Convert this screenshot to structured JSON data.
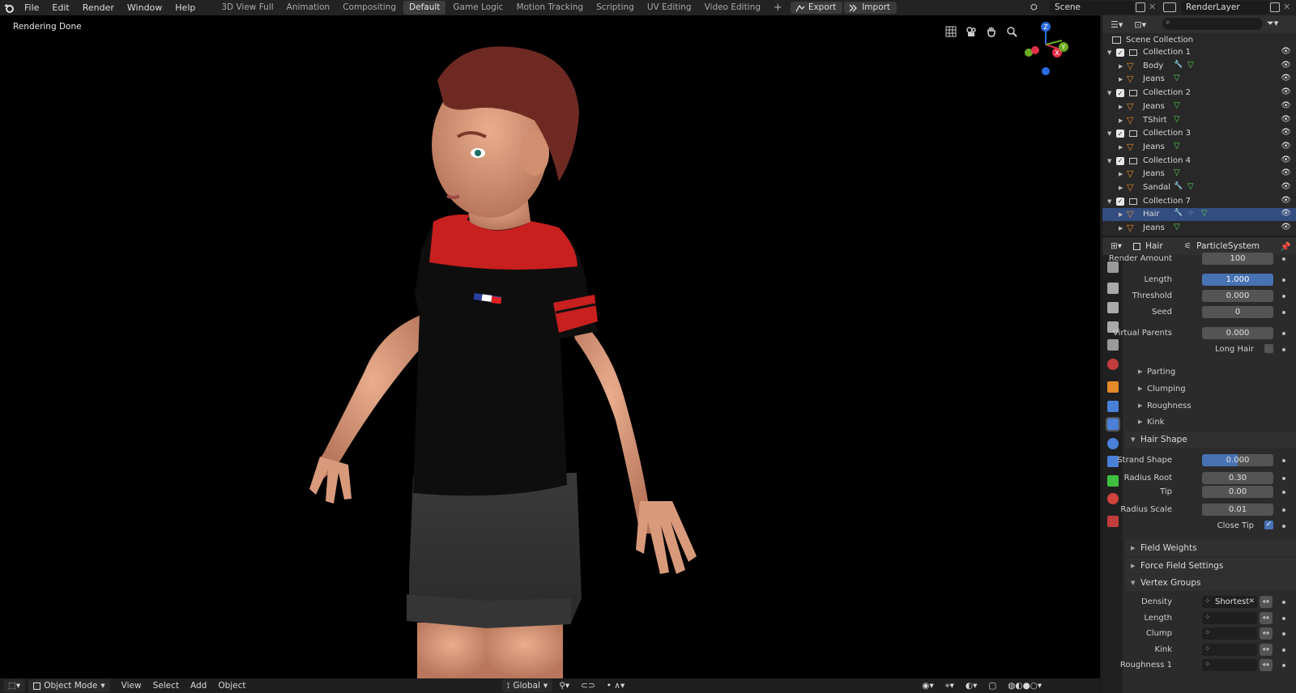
{
  "topbar": {
    "menus": [
      "File",
      "Edit",
      "Render",
      "Window",
      "Help"
    ],
    "workspaces": [
      "3D View Full",
      "Animation",
      "Compositing",
      "Default",
      "Game Logic",
      "Motion Tracking",
      "Scripting",
      "UV Editing",
      "Video Editing"
    ],
    "active_workspace": "Default",
    "add_tab": "+",
    "export_label": "Export",
    "import_label": "Import",
    "scene_name": "Scene",
    "render_layer": "RenderLayer"
  },
  "viewport": {
    "status": "Rendering Done",
    "gizmo": {
      "z": "Z",
      "x": "X",
      "y": "Y"
    }
  },
  "bottombar": {
    "mode": "Object Mode",
    "menus": [
      "View",
      "Select",
      "Add",
      "Object"
    ],
    "transform_orientation": "Global"
  },
  "outliner": {
    "root": "Scene Collection",
    "rows": [
      {
        "label": "Collection 1",
        "kind": "collection"
      },
      {
        "label": "Body",
        "kind": "object",
        "extras": [
          "wrench",
          "mesh"
        ]
      },
      {
        "label": "Jeans",
        "kind": "object",
        "extras": [
          "mesh"
        ]
      },
      {
        "label": "Collection 2",
        "kind": "collection"
      },
      {
        "label": "Jeans",
        "kind": "object",
        "extras": [
          "mesh"
        ]
      },
      {
        "label": "TShirt",
        "kind": "object",
        "extras": [
          "mesh"
        ]
      },
      {
        "label": "Collection 3",
        "kind": "collection"
      },
      {
        "label": "Jeans",
        "kind": "object",
        "extras": [
          "mesh"
        ]
      },
      {
        "label": "Collection 4",
        "kind": "collection"
      },
      {
        "label": "Jeans",
        "kind": "object",
        "extras": [
          "mesh"
        ]
      },
      {
        "label": "Sandal",
        "kind": "object",
        "extras": [
          "wrench",
          "mesh"
        ]
      },
      {
        "label": "Collection 7",
        "kind": "collection"
      },
      {
        "label": "Hair",
        "kind": "object",
        "extras": [
          "wrench",
          "particles",
          "mesh"
        ],
        "selected": true
      },
      {
        "label": "Jeans",
        "kind": "object",
        "extras": [
          "mesh"
        ]
      }
    ]
  },
  "properties": {
    "object_name": "Hair",
    "particle_system": "ParticleSystem",
    "render_amount_label": "Render Amount",
    "render_amount": "100",
    "length_label": "Length",
    "length": "1.000",
    "threshold_label": "Threshold",
    "threshold": "0.000",
    "seed_label": "Seed",
    "seed": "0",
    "virtual_parents_label": "Virtual Parents",
    "virtual_parents": "0.000",
    "long_hair_label": "Long Hair",
    "long_hair": false,
    "subpanels": [
      "Parting",
      "Clumping",
      "Roughness",
      "Kink"
    ],
    "hair_shape": {
      "title": "Hair Shape",
      "strand_shape_label": "Strand Shape",
      "strand_shape": "0.000",
      "radius_root_label": "Radius Root",
      "radius_root": "0.30",
      "tip_label": "Tip",
      "tip": "0.00",
      "radius_scale_label": "Radius Scale",
      "radius_scale": "0.01",
      "close_tip_label": "Close Tip",
      "close_tip": true
    },
    "field_weights": "Field Weights",
    "force_field_settings": "Force Field Settings",
    "vertex_groups": {
      "title": "Vertex Groups",
      "rows": [
        {
          "label": "Density",
          "value": "Shortest"
        },
        {
          "label": "Length",
          "value": ""
        },
        {
          "label": "Clump",
          "value": ""
        },
        {
          "label": "Kink",
          "value": ""
        },
        {
          "label": "Roughness 1",
          "value": ""
        }
      ]
    }
  }
}
